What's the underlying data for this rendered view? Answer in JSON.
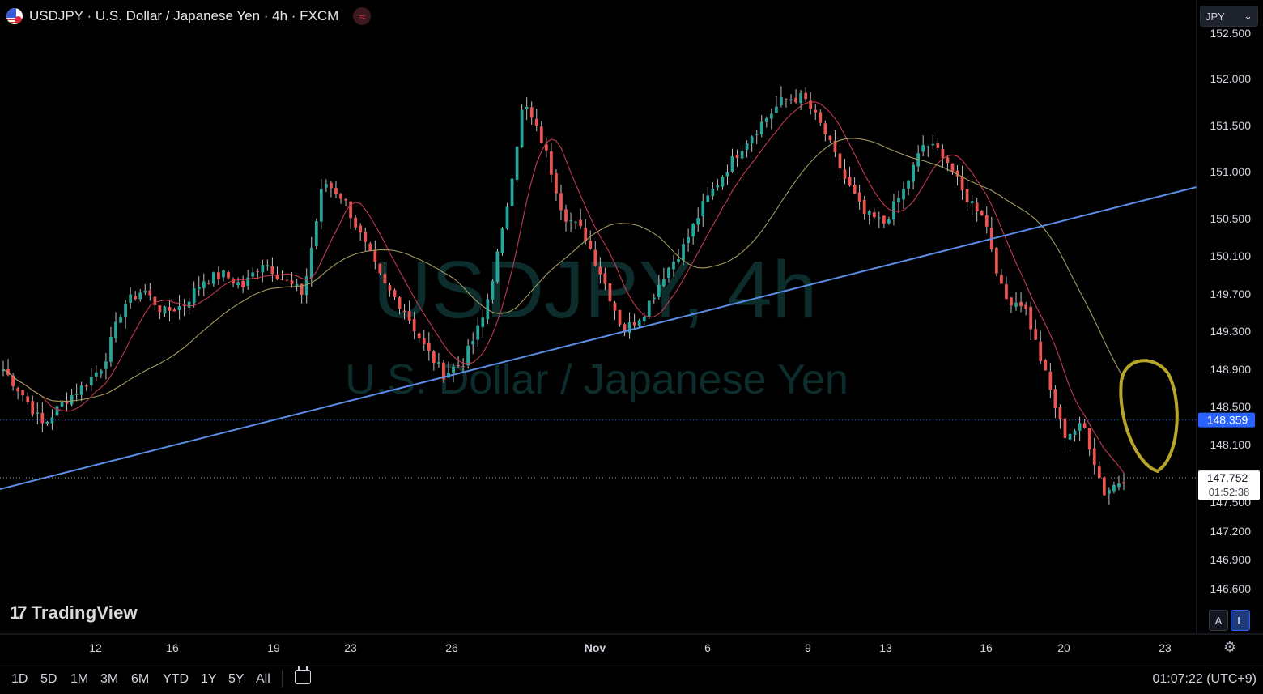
{
  "header": {
    "symbol_title": "USDJPY · U.S. Dollar / Japanese Yen · 4h · FXCM",
    "indicator_badge": "≈",
    "currency_select": "JPY",
    "currency_chevron": "⌄"
  },
  "watermark": {
    "line1": "USDJPY, 4h",
    "line2": "U.S. Dollar / Japanese Yen"
  },
  "logo_text": "TradingView",
  "logo_mark": "17",
  "scale_buttons": {
    "auto": "A",
    "log": "L"
  },
  "range_buttons": [
    "1D",
    "5D",
    "1M",
    "3M",
    "6M",
    "YTD",
    "1Y",
    "5Y",
    "All"
  ],
  "clock": "01:07:22 (UTC+9)",
  "colors": {
    "up": "#26a69a",
    "down": "#ef5350",
    "trendline": "#5b8ee6",
    "ma_fast": "#c2394f",
    "ma_slow": "#a59a5f",
    "annotation": "#b7a62a",
    "price_label_blue": "#2962ff"
  },
  "chart_data": {
    "type": "candlestick",
    "title": "USDJPY · U.S. Dollar / Japanese Yen · 4h · FXCM",
    "y_ticks": [
      "152.500",
      "152.000",
      "151.500",
      "151.000",
      "150.500",
      "150.100",
      "149.700",
      "149.300",
      "148.900",
      "148.500",
      "148.100",
      "147.500",
      "147.200",
      "146.900",
      "146.600"
    ],
    "x_ticks": [
      "12",
      "16",
      "19",
      "23",
      "26",
      "Nov",
      "6",
      "9",
      "13",
      "16",
      "20",
      "23"
    ],
    "price_labels": [
      {
        "value": "148.359",
        "style": "blue"
      },
      {
        "value": "147.752",
        "countdown": "01:52:38",
        "style": "white"
      }
    ],
    "last_price": 147.752,
    "reference_price": 148.359,
    "ohlc_close_path": [
      148.9,
      148.62,
      148.3,
      148.55,
      148.72,
      148.95,
      149.58,
      149.75,
      149.5,
      149.58,
      149.85,
      149.9,
      149.78,
      150.05,
      149.85,
      149.7,
      150.9,
      150.72,
      150.25,
      149.8,
      149.55,
      149.15,
      148.85,
      148.98,
      149.45,
      150.4,
      151.75,
      151.3,
      150.55,
      150.35,
      149.85,
      149.3,
      149.5,
      149.9,
      150.2,
      150.65,
      150.98,
      151.3,
      151.55,
      151.78,
      151.8,
      151.45,
      150.95,
      150.55,
      150.45,
      150.8,
      151.3,
      151.2,
      150.75,
      150.55,
      149.65,
      149.6,
      148.9,
      148.2,
      148.3,
      147.6,
      147.75
    ],
    "moving_averages": [
      {
        "period_hint": "fast",
        "color": "#c2394f"
      },
      {
        "period_hint": "slow",
        "color": "#a59a5f"
      }
    ]
  }
}
